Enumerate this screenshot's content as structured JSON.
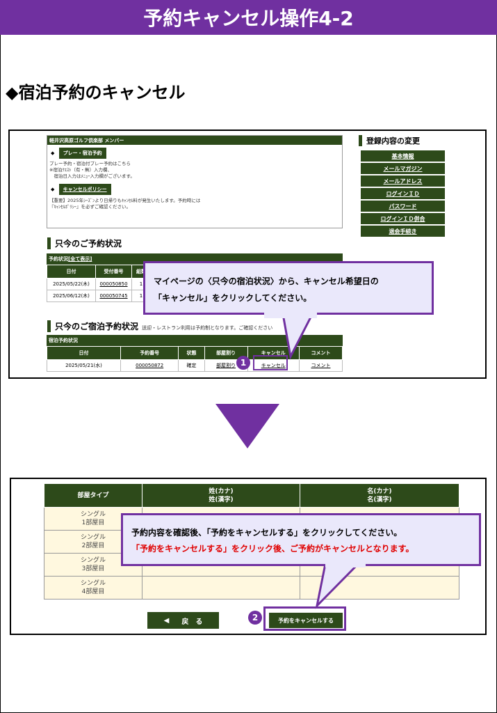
{
  "header": {
    "title": "予約キャンセル操作4-2"
  },
  "section_title": "◆宿泊予約のキャンセル",
  "panel1": {
    "member_head": "軽井沢高原ゴルフ倶楽部 メンバー",
    "play_pill": "プレー・宿泊予約",
    "play_text_1": "プレー予約・宿泊付プレー予約はこちら",
    "play_text_2": "※宿泊ｸｴｽﾄ（有・無）入力欄、",
    "play_text_3": "　宿泊日入力はﾒﾆｭｰ入力欄がございます。",
    "cancel_policy_pill": "キャンセルポリシー",
    "policy_text_1": "【重要】2025年ｼｰｽﾞﾝより日帰りもｷｬﾝｾﾙ料が発生いたします。予約時には",
    "policy_text_2": "『ｷｬﾝｾﾙﾎﾟﾘｼｰ』を必ずご確認ください。",
    "right_menu_title": "登録内容の変更",
    "right_menu_items": [
      "基本情報",
      "メールマガジン",
      "メールアドレス",
      "ログインＩＤ",
      "パスワード",
      "ログインＩＤ併合",
      "退会手続き"
    ],
    "current_reservations_heading": "只今のご予約状況",
    "reservation_caption": "予約状況",
    "reservation_show_all": "[全て表示]",
    "reservation_headers": [
      "日付",
      "受付番号",
      "組数"
    ],
    "reservation_rows": [
      [
        "2025/05/22(木)",
        "000050850",
        "1"
      ],
      [
        "2025/06/12(木)",
        "000050745",
        "1"
      ]
    ],
    "stay_heading": "只今のご宿泊予約状況",
    "stay_heading_note": "送迎・レストラン利用は予約制となります。ご確認ください",
    "stay_caption": "宿泊予約状況",
    "stay_headers": [
      "日付",
      "予約番号",
      "状態",
      "部屋割り",
      "キャンセル",
      "コメント"
    ],
    "stay_row": [
      "2025/05/21(水)",
      "000050872",
      "確定",
      "部屋割り",
      "キャンセル",
      "コメント"
    ]
  },
  "callout1": {
    "line1": "マイページの〈只今の宿泊状況〉から、キャンセル希望日の",
    "line2": "「キャンセル」をクリックしてください。"
  },
  "badge1": "1",
  "panel2": {
    "headers": [
      "部屋タイプ",
      "姓(カナ)",
      "姓(漢字)",
      "名(カナ)",
      "名(漢字)"
    ],
    "rooms": [
      [
        "シングル",
        "1部屋目"
      ],
      [
        "シングル",
        "2部屋目"
      ],
      [
        "シングル",
        "3部屋目"
      ],
      [
        "シングル",
        "4部屋目"
      ]
    ],
    "back_icon": "◀",
    "back_label": "戻　る",
    "cancel_label": "予約をキャンセルする"
  },
  "callout2": {
    "line1": "予約内容を確認後、「予約をキャンセルする」をクリックしてください。",
    "line2": "「予約をキャンセルする」をクリック後、ご予約がキャンセルとなります。"
  },
  "badge2": "2",
  "colors": {
    "accent": "#7030a0",
    "green": "#2d4a1a",
    "warning": "#e00000"
  }
}
